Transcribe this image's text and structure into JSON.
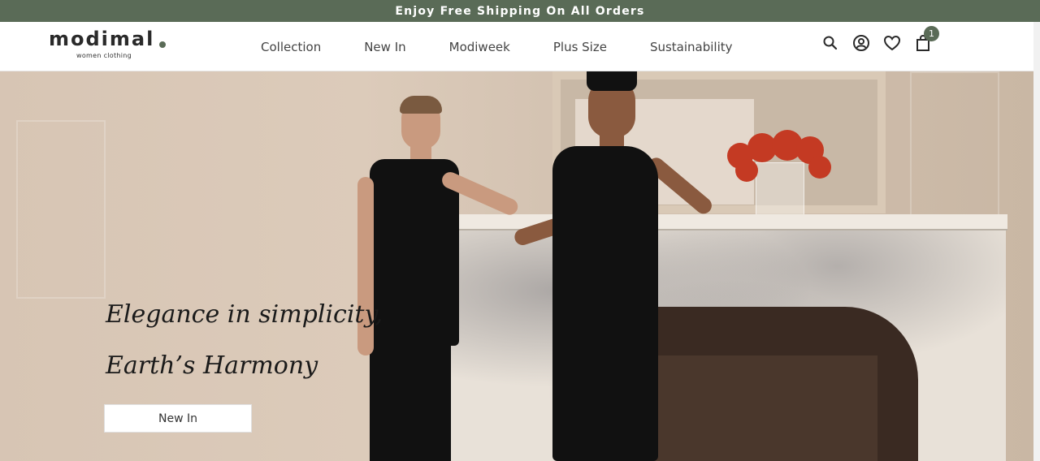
{
  "promo": {
    "text": "Enjoy Free Shipping On All Orders"
  },
  "brand": {
    "name": "modimal",
    "tagline": "women clothing"
  },
  "nav": {
    "items": [
      {
        "label": "Collection"
      },
      {
        "label": "New In"
      },
      {
        "label": "Modiweek"
      },
      {
        "label": "Plus Size"
      },
      {
        "label": "Sustainability"
      }
    ]
  },
  "header_icons": {
    "search": "search-icon",
    "account": "user-circle-icon",
    "wishlist": "heart-icon",
    "cart": "shopping-bag-icon",
    "cart_count": "1"
  },
  "hero": {
    "headline_line1": "Elegance in simplicity,",
    "headline_line2": "Earth’s Harmony",
    "cta_label": "New In"
  },
  "colors": {
    "accent": "#5a6b57",
    "background": "#ffffff",
    "text": "#1a1a1a"
  }
}
